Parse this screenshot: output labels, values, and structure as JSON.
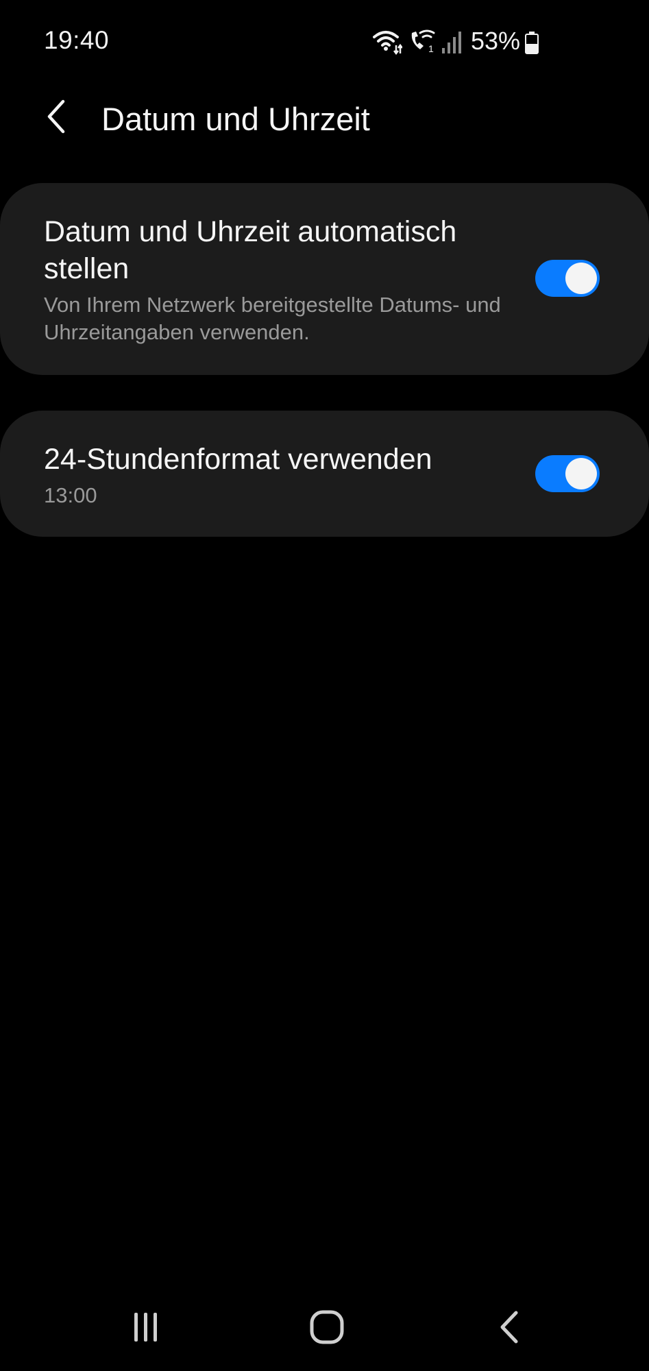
{
  "status_bar": {
    "time": "19:40",
    "battery_percent": "53%",
    "icons": [
      "wifi-icon",
      "wifi-calling-icon",
      "signal-icon",
      "battery-icon"
    ]
  },
  "header": {
    "title": "Datum und Uhrzeit",
    "back_icon": "chevron-left-icon"
  },
  "settings": {
    "auto_datetime": {
      "title": "Datum und Uhrzeit automatisch stellen",
      "subtitle": "Von Ihrem Netzwerk bereitgestellte Datums- und Uhrzeitangaben verwenden.",
      "enabled": true
    },
    "format_24h": {
      "title": "24-Stundenformat verwenden",
      "subtitle": "13:00",
      "enabled": true
    }
  },
  "navigation": {
    "items": [
      "recents-icon",
      "home-icon",
      "back-icon"
    ]
  },
  "colors": {
    "background": "#000000",
    "card": "#1c1c1c",
    "accent": "#0a7cff",
    "primary_text": "#f5f5f5",
    "secondary_text": "#9a9a9a"
  }
}
